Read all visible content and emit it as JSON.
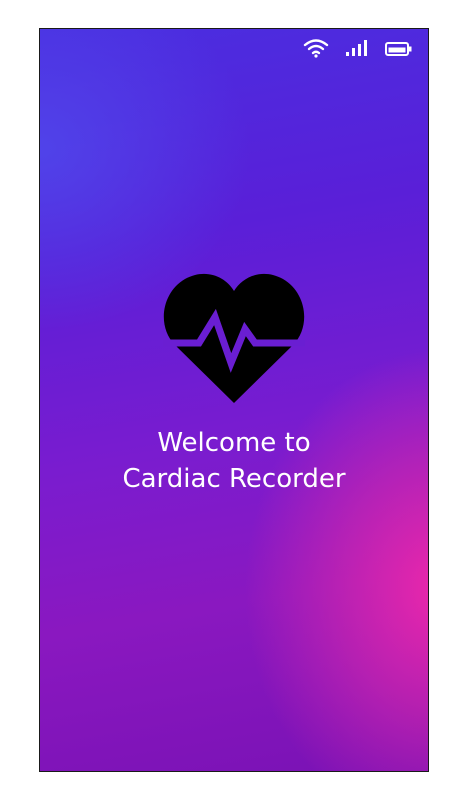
{
  "status_bar": {
    "icons": [
      "wifi-icon",
      "cellular-signal-icon",
      "battery-icon"
    ]
  },
  "splash": {
    "logo_icon": "heart-pulse-icon",
    "welcome_line1": "Welcome to",
    "welcome_line2": "Cardiac Recorder"
  },
  "colors": {
    "gradient_top": "#4a2ee0",
    "gradient_mid": "#7a1ccf",
    "gradient_accent": "#f028aa",
    "text": "#ffffff",
    "icon": "#000000"
  }
}
